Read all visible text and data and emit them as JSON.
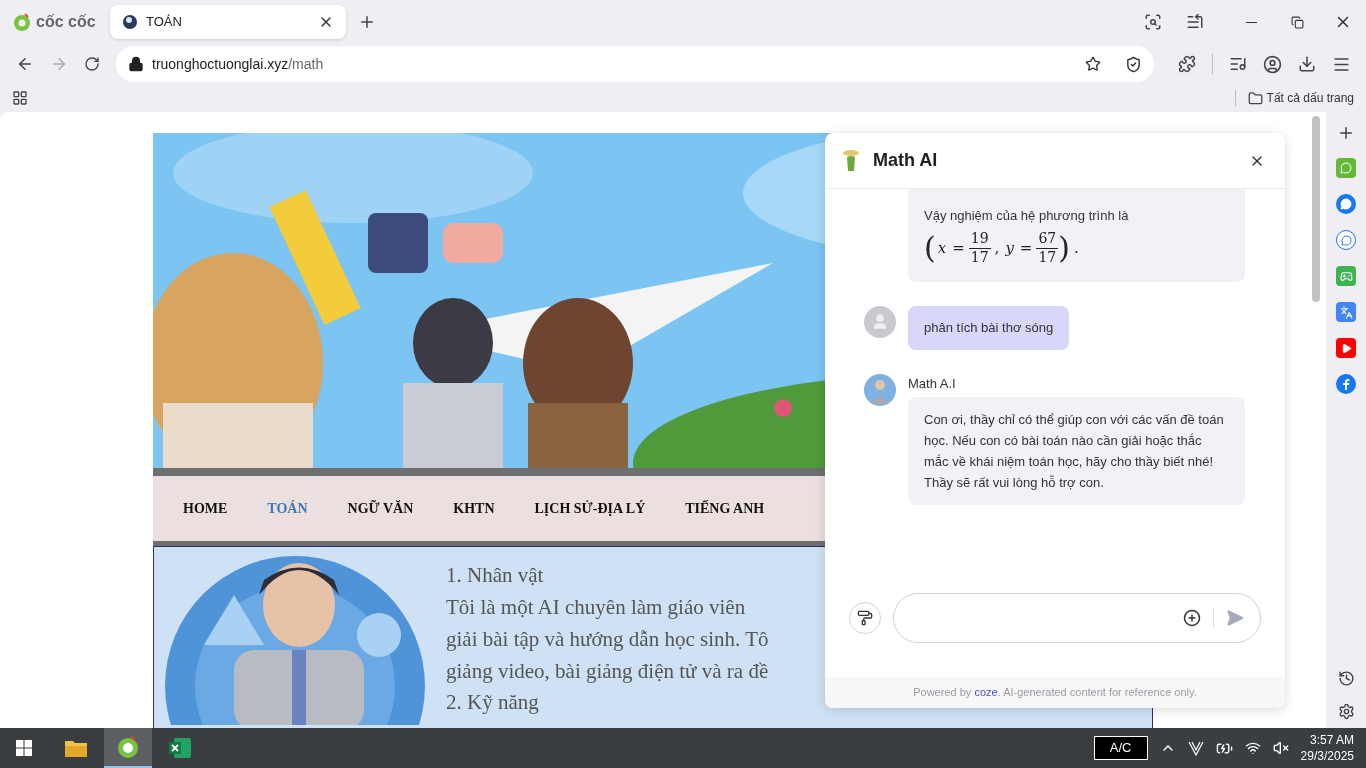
{
  "browser": {
    "logo_text": "cốc cốc",
    "tabs": [
      {
        "title": "TOÁN",
        "selected": true
      }
    ],
    "url_host": "truonghoctuonglai.xyz",
    "url_path": "/math",
    "bookmarks_label": "Tất cả dấu trang"
  },
  "site": {
    "nav": [
      {
        "label": "HOME",
        "selected": false
      },
      {
        "label": "TOÁN",
        "selected": true
      },
      {
        "label": "NGỮ VĂN",
        "selected": false
      },
      {
        "label": "KHTN",
        "selected": false
      },
      {
        "label": "LỊCH SỬ-ĐỊA LÝ",
        "selected": false
      },
      {
        "label": "TIẾNG ANH",
        "selected": false
      }
    ],
    "heading": "1. Nhân vật",
    "paragraph_lines": [
      "Tôi là một AI chuyên làm giáo viên",
      "giải bài tập và hướng dẫn học sinh. Tô",
      "giảng video, bài giảng điện tử và ra đề"
    ],
    "heading_2": "2. Kỹ năng"
  },
  "chat": {
    "title": "Math AI",
    "messages": [
      {
        "kind": "bot",
        "text": "Vậy nghiệm của hệ phương trình là",
        "math": [
          {
            "kind": "paren",
            "text": "("
          },
          {
            "kind": "var",
            "text": "x"
          },
          {
            "kind": "op",
            "text": "="
          },
          {
            "kind": "frac",
            "num": "19",
            "den": "17"
          },
          {
            "kind": "op",
            "text": ","
          },
          {
            "kind": "var",
            "text": "y"
          },
          {
            "kind": "op",
            "text": "="
          },
          {
            "kind": "frac",
            "num": "67",
            "den": "17"
          },
          {
            "kind": "paren",
            "text": ")"
          },
          {
            "kind": "op",
            "text": "."
          }
        ]
      },
      {
        "kind": "user",
        "text": "phân tích bài thơ sóng"
      },
      {
        "kind": "bot",
        "sender": "Math A.I",
        "text": "Con ơi, thầy chỉ có thể giúp con với các vấn đề toán học. Nếu con có bài toán nào cần giải hoặc thắc mắc về khái niệm toán học, hãy cho thầy biết nhé! Thầy sẽ rất vui lòng hỗ trợ con."
      }
    ],
    "footer": {
      "before": "Powered by",
      "link": "coze",
      "after": ". AI-generated content for reference only."
    }
  },
  "taskbar": {
    "apps": [
      {
        "kind": "folder",
        "selected": false
      },
      {
        "kind": "browser",
        "selected": true
      },
      {
        "kind": "sheet",
        "selected": false
      }
    ],
    "power_label": "A/C",
    "time": "3:57 AM",
    "date": "29/3/2025"
  }
}
